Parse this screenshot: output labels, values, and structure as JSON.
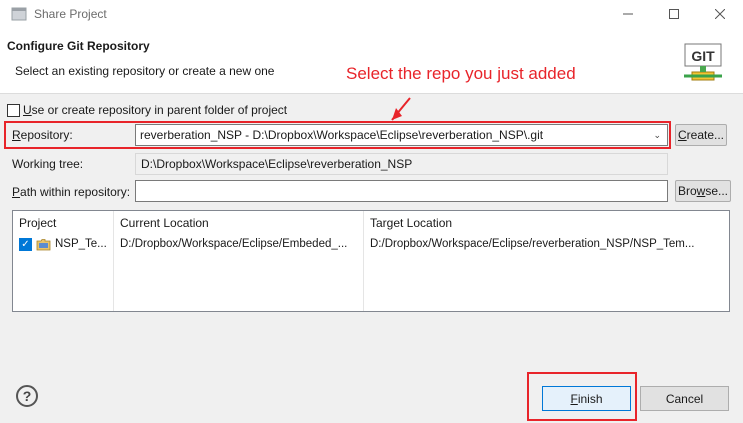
{
  "window": {
    "title": "Share Project",
    "minimize_icon": "minimize-icon",
    "maximize_icon": "maximize-icon",
    "close_icon": "close-icon"
  },
  "header": {
    "title": "Configure Git Repository",
    "subtitle": "Select an existing repository or create a new one",
    "annotation": "Select the repo you just added",
    "logo_text": "GIT"
  },
  "parent_folder": {
    "label_u": "U",
    "label_rest": "se or create repository in parent folder of project",
    "checked": false
  },
  "repository": {
    "label_u": "R",
    "label_rest": "epository:",
    "value": "reverberation_NSP - D:\\Dropbox\\Workspace\\Eclipse\\reverberation_NSP\\.git",
    "create_u": "C",
    "create_rest": "reate..."
  },
  "working_tree": {
    "label": "Working tree:",
    "value": "D:\\Dropbox\\Workspace\\Eclipse\\reverberation_NSP"
  },
  "path": {
    "label_u": "P",
    "label_rest": "ath within repository:",
    "value": "",
    "browse_u": "w",
    "browse_pre": "Bro",
    "browse_post": "se..."
  },
  "table": {
    "columns": [
      "Project",
      "Current Location",
      "Target Location"
    ],
    "rows": [
      {
        "checked": true,
        "project": "NSP_Te...",
        "current": "D:/Dropbox/Workspace/Eclipse/Embeded_...",
        "target": "D:/Dropbox/Workspace/Eclipse/reverberation_NSP/NSP_Tem..."
      }
    ]
  },
  "footer": {
    "help": "?",
    "finish_u": "F",
    "finish_rest": "inish",
    "cancel": "Cancel"
  },
  "colors": {
    "highlight": "#e8242a",
    "accent": "#0078d7"
  }
}
